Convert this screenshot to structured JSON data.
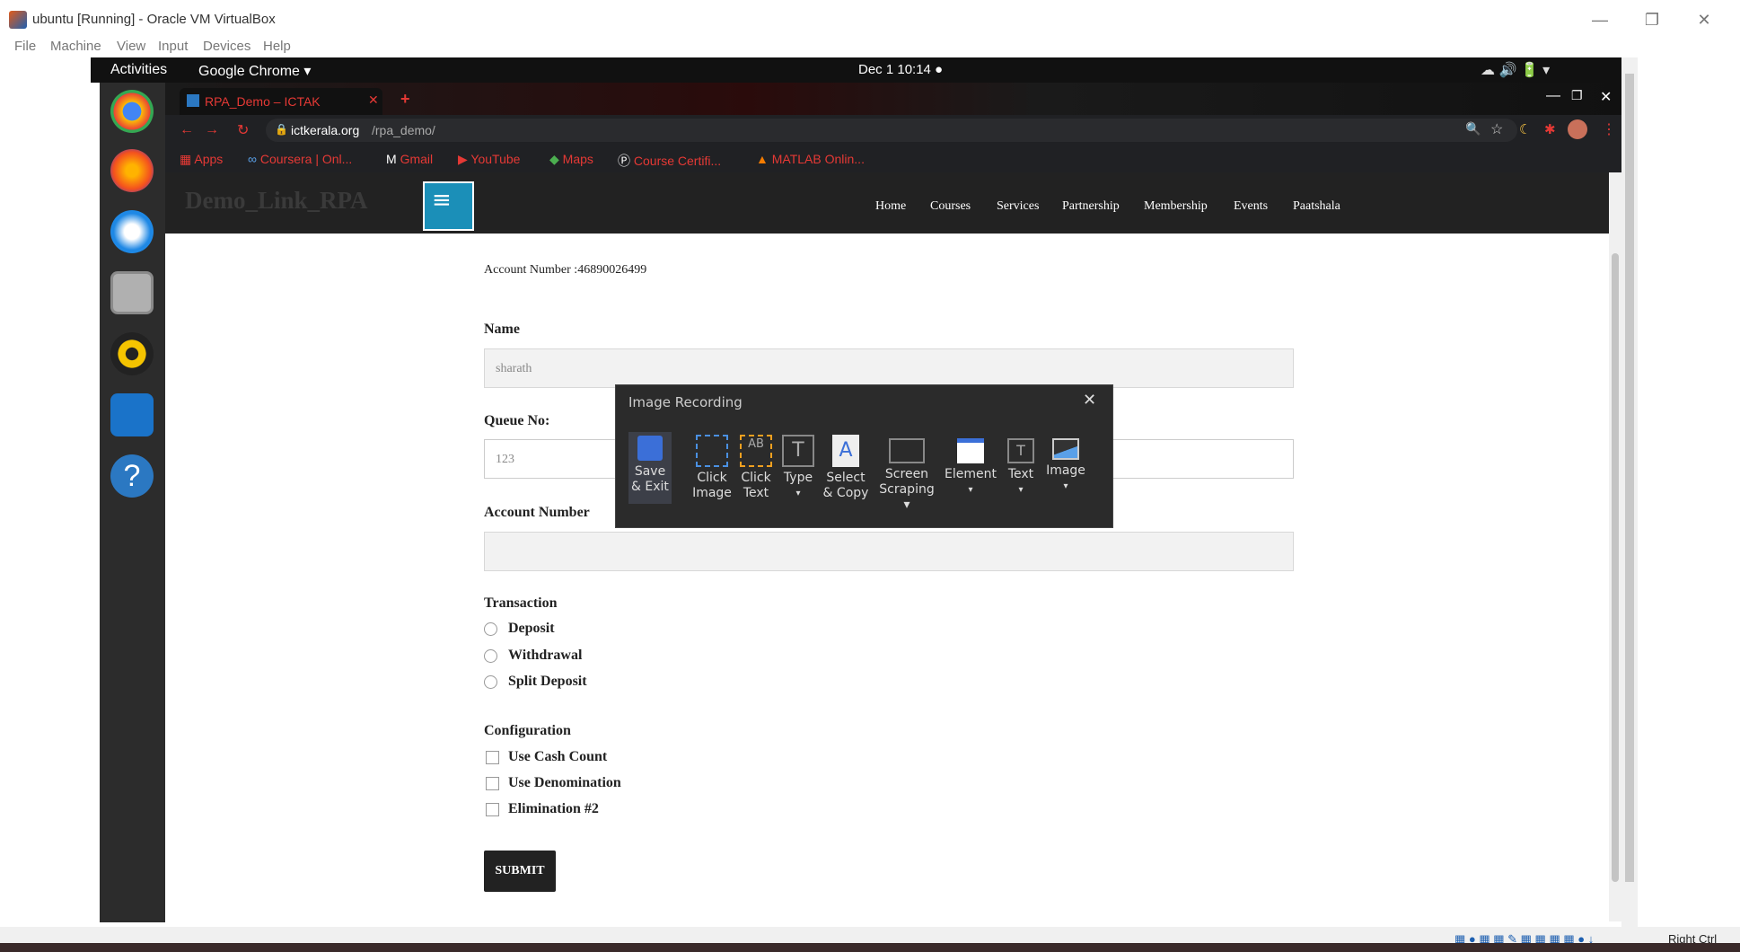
{
  "vbox": {
    "title": "ubuntu [Running] - Oracle VM VirtualBox",
    "menu": [
      "File",
      "Machine",
      "View",
      "Input",
      "Devices",
      "Help"
    ],
    "host_key": "Right Ctrl"
  },
  "gnome": {
    "activities": "Activities",
    "app_name": "Google Chrome ▾",
    "clock": "Dec 1  10:14  ●"
  },
  "chrome": {
    "tab_title": "RPA_Demo – ICTAK",
    "url_domain": "ictkerala.org",
    "url_path": "/rpa_demo/",
    "bookmarks": [
      "Apps",
      "Coursera | Onl...",
      "Gmail",
      "YouTube",
      "Maps",
      "Course Certifi...",
      "MATLAB Onlin..."
    ]
  },
  "site": {
    "brand": "Demo_Link_RPA",
    "nav": [
      "Home",
      "Courses",
      "Services",
      "Partnership",
      "Membership",
      "Events",
      "Paatshala"
    ]
  },
  "form": {
    "account_number_line": "Account Number :46890026499",
    "name_label": "Name",
    "name_value": "sharath",
    "queue_label": "Queue No:",
    "queue_placeholder": "123",
    "account_label": "Account Number",
    "account_value": "",
    "transaction_label": "Transaction",
    "transactions": [
      "Deposit",
      "Withdrawal",
      "Split Deposit"
    ],
    "config_label": "Configuration",
    "configs": [
      "Use Cash Count",
      "Use Denomination",
      "Elimination #2"
    ],
    "submit": "SUBMIT"
  },
  "recorder": {
    "title": "Image Recording",
    "tools": [
      {
        "line1": "Save",
        "line2": "& Exit",
        "icon": "save-icon"
      },
      {
        "line1": "Click",
        "line2": "Image",
        "icon": "click-image-icon"
      },
      {
        "line1": "Click",
        "line2": "Text",
        "icon": "click-text-icon"
      },
      {
        "line1": "Type",
        "line2": "▾",
        "icon": "type-icon"
      },
      {
        "line1": "Select",
        "line2": "& Copy",
        "icon": "select-copy-icon"
      },
      {
        "line1": "Screen",
        "line2": "Scraping ▾",
        "icon": "screen-scraping-icon"
      },
      {
        "line1": "Element",
        "line2": "▾",
        "icon": "element-icon"
      },
      {
        "line1": "Text",
        "line2": "▾",
        "icon": "text-icon"
      },
      {
        "line1": "Image",
        "line2": "▾",
        "icon": "image-icon"
      }
    ]
  },
  "colors": {
    "tab_red": "#e53935",
    "site_header": "#222222",
    "accent_blue": "#2b78c2",
    "dialog_bg": "#2b2b2b"
  }
}
